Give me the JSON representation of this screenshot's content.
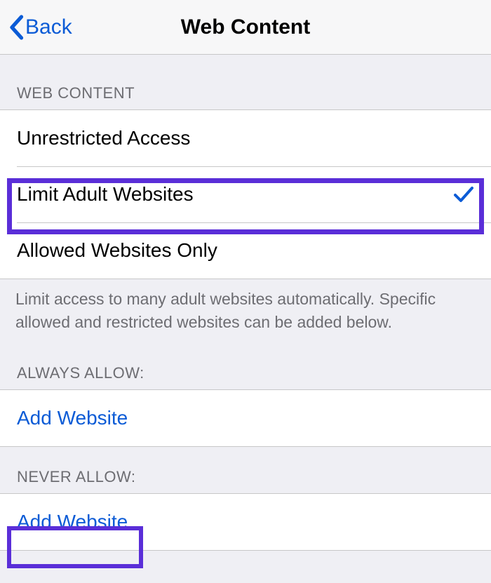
{
  "navbar": {
    "back_label": "Back",
    "title": "Web Content"
  },
  "webcontent": {
    "header": "WEB CONTENT",
    "options": [
      {
        "label": "Unrestricted Access",
        "selected": false
      },
      {
        "label": "Limit Adult Websites",
        "selected": true
      },
      {
        "label": "Allowed Websites Only",
        "selected": false
      }
    ],
    "footer": "Limit access to many adult websites automatically. Specific allowed and restricted websites can be added below."
  },
  "always_allow": {
    "header": "ALWAYS ALLOW:",
    "add_label": "Add Website"
  },
  "never_allow": {
    "header": "NEVER ALLOW:",
    "add_label": "Add Website"
  }
}
